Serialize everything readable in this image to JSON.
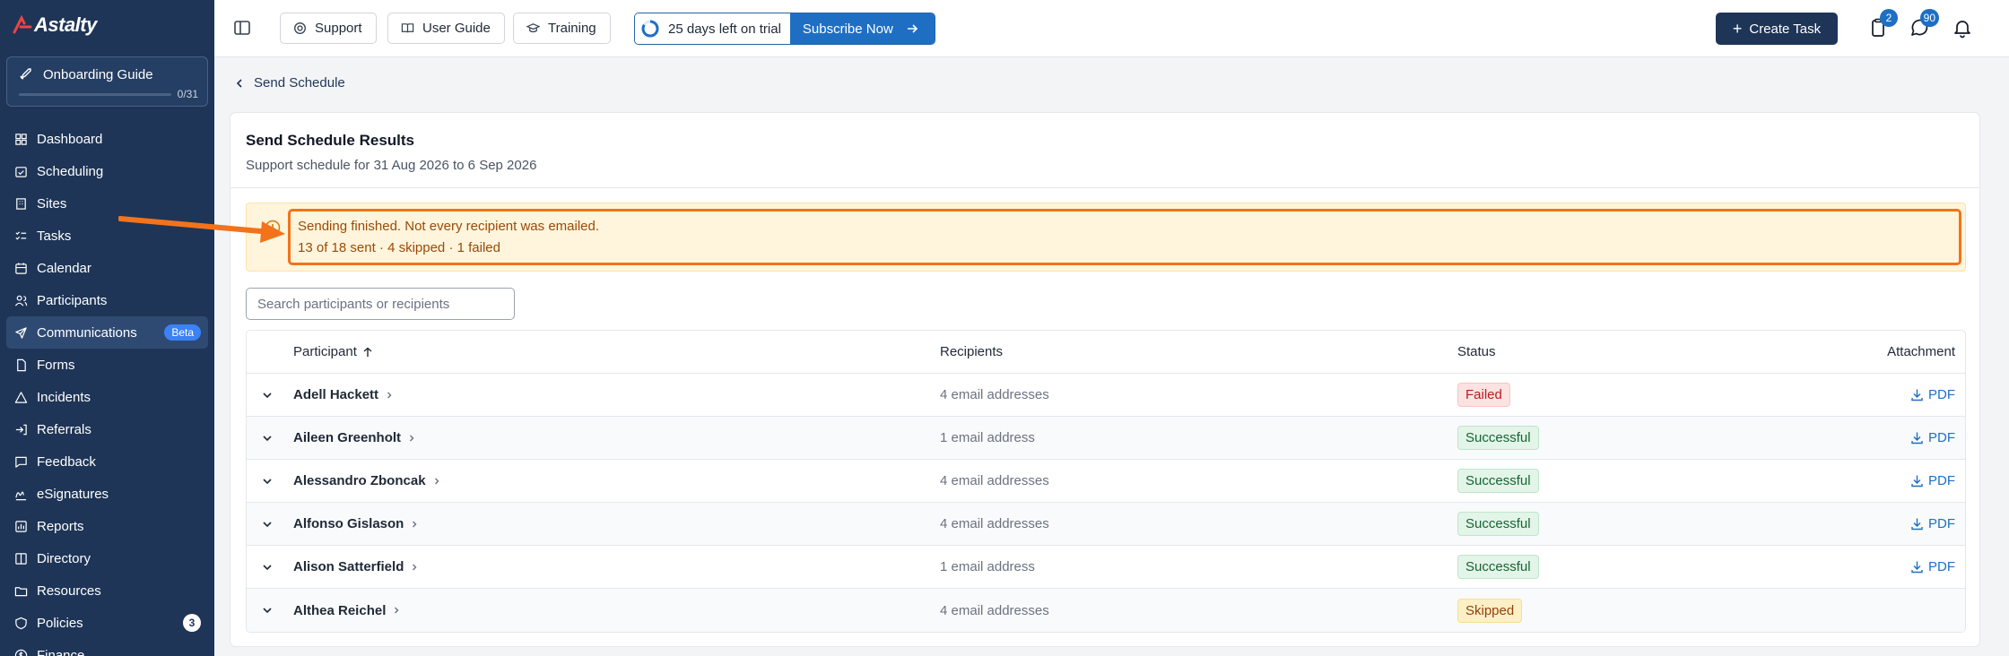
{
  "app": {
    "logo_text": "Astalty"
  },
  "onboarding": {
    "title": "Onboarding Guide",
    "count": "0/31",
    "progress_fraction": 0
  },
  "sidebar": {
    "items": [
      {
        "label": "Dashboard",
        "icon": "dashboard-icon"
      },
      {
        "label": "Scheduling",
        "icon": "calendar-check-icon"
      },
      {
        "label": "Sites",
        "icon": "building-icon"
      },
      {
        "label": "Tasks",
        "icon": "list-check-icon"
      },
      {
        "label": "Calendar",
        "icon": "calendar-icon"
      },
      {
        "label": "Participants",
        "icon": "users-icon"
      },
      {
        "label": "Communications",
        "icon": "send-icon",
        "badge": "Beta",
        "active": true
      },
      {
        "label": "Forms",
        "icon": "file-icon"
      },
      {
        "label": "Incidents",
        "icon": "warning-triangle-icon"
      },
      {
        "label": "Referrals",
        "icon": "arrow-in-icon"
      },
      {
        "label": "Feedback",
        "icon": "message-square-icon"
      },
      {
        "label": "eSignatures",
        "icon": "signature-icon"
      },
      {
        "label": "Reports",
        "icon": "chart-icon"
      },
      {
        "label": "Directory",
        "icon": "book-open-icon"
      },
      {
        "label": "Resources",
        "icon": "folder-icon"
      },
      {
        "label": "Policies",
        "icon": "shield-icon",
        "count": "3"
      },
      {
        "label": "Finance",
        "icon": "dollar-icon"
      }
    ]
  },
  "topbar": {
    "support_label": "Support",
    "guide_label": "User Guide",
    "training_label": "Training",
    "trial_text": "25 days left on trial",
    "subscribe_label": "Subscribe Now",
    "create_task_label": "Create Task",
    "tasks_badge": "2",
    "messages_badge": "90"
  },
  "breadcrumb": {
    "back_label": "Send Schedule"
  },
  "card": {
    "title": "Send Schedule Results",
    "subtitle": "Support schedule for 31 Aug 2026 to 6 Sep 2026"
  },
  "alert": {
    "line1": "Sending finished. Not every recipient was emailed.",
    "line2": "13 of 18 sent · 4 skipped · 1 failed"
  },
  "search": {
    "placeholder": "Search participants or recipients"
  },
  "table": {
    "headers": {
      "participant": "Participant",
      "recipients": "Recipients",
      "status": "Status",
      "attachment": "Attachment"
    },
    "rows": [
      {
        "name": "Adell Hackett",
        "recipients": "4 email addresses",
        "status": "Failed",
        "status_kind": "failed",
        "attachment": "PDF"
      },
      {
        "name": "Aileen Greenholt",
        "recipients": "1 email address",
        "status": "Successful",
        "status_kind": "success",
        "attachment": "PDF"
      },
      {
        "name": "Alessandro Zboncak",
        "recipients": "4 email addresses",
        "status": "Successful",
        "status_kind": "success",
        "attachment": "PDF"
      },
      {
        "name": "Alfonso Gislason",
        "recipients": "4 email addresses",
        "status": "Successful",
        "status_kind": "success",
        "attachment": "PDF"
      },
      {
        "name": "Alison Satterfield",
        "recipients": "1 email address",
        "status": "Successful",
        "status_kind": "success",
        "attachment": "PDF"
      },
      {
        "name": "Althea Reichel",
        "recipients": "4 email addresses",
        "status": "Skipped",
        "status_kind": "skipped",
        "attachment": ""
      }
    ]
  },
  "colors": {
    "sidebar_bg": "#1e3557",
    "accent": "#1e6fc4",
    "highlight": "#f2731b"
  }
}
